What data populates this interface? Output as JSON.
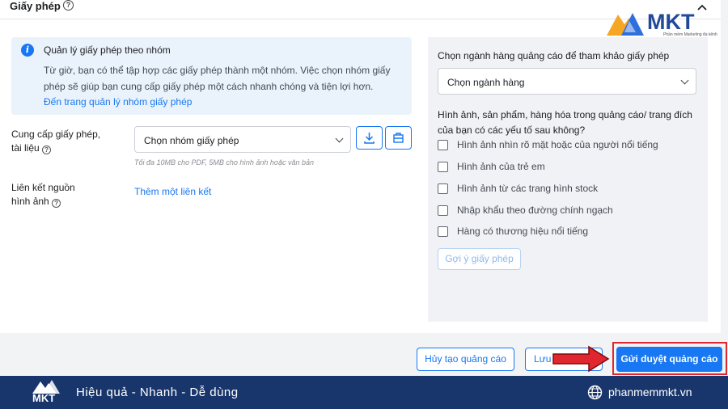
{
  "header": {
    "title": "Giấy phép",
    "help_icon": "help-circle-icon",
    "collapse_icon": "chevron-up-icon"
  },
  "info_box": {
    "title": "Quản lý giấy phép theo nhóm",
    "body": "Từ giờ, bạn có thể tập hợp các giấy phép thành một nhóm. Việc chọn nhóm giấy phép sẽ giúp bạn cung cấp giấy phép một cách nhanh chóng và tiện lợi hơn.",
    "link": "Đến trang quản lý nhóm giấy phép"
  },
  "license_field": {
    "label_line1": "Cung cấp giấy phép,",
    "label_line2": "tài liệu",
    "select_value": "Chọn nhóm giấy phép",
    "hint": "Tối đa 10MB cho PDF, 5MB cho hình ảnh hoặc văn bản"
  },
  "source_link_field": {
    "label_line1": "Liên kết nguồn",
    "label_line2": "hình ảnh",
    "add_link": "Thêm một liên kết"
  },
  "right_panel": {
    "heading": "Chọn ngành hàng quảng cáo để tham khảo giấy phép",
    "select_value": "Chọn ngành hàng",
    "question": "Hình ảnh, sản phẩm, hàng hóa trong quảng cáo/ trang đích của bạn có các yếu tố sau không?",
    "options": [
      "Hình ảnh nhìn rõ mặt hoặc của người nổi tiếng",
      "Hình ảnh của trẻ em",
      "Hình ảnh từ các trang hình stock",
      "Nhập khẩu theo đường chính ngạch",
      "Hàng có thương hiệu nổi tiếng"
    ],
    "suggest_button": "Gợi ý giấy phép"
  },
  "actions": {
    "cancel": "Hủy tạo quảng cáo",
    "save": "Lưu",
    "submit": "Gửi duyệt quảng cáo"
  },
  "footer": {
    "tagline": "Hiệu quả - Nhanh - Dễ dùng",
    "website": "phanmemmkt.vn"
  },
  "watermark": {
    "brand": "MKT",
    "subtitle": "Phần mềm Marketing đa kênh"
  },
  "colors": {
    "accent": "#1877f2",
    "footer_bg": "#19366c",
    "highlight": "#e0262f"
  }
}
